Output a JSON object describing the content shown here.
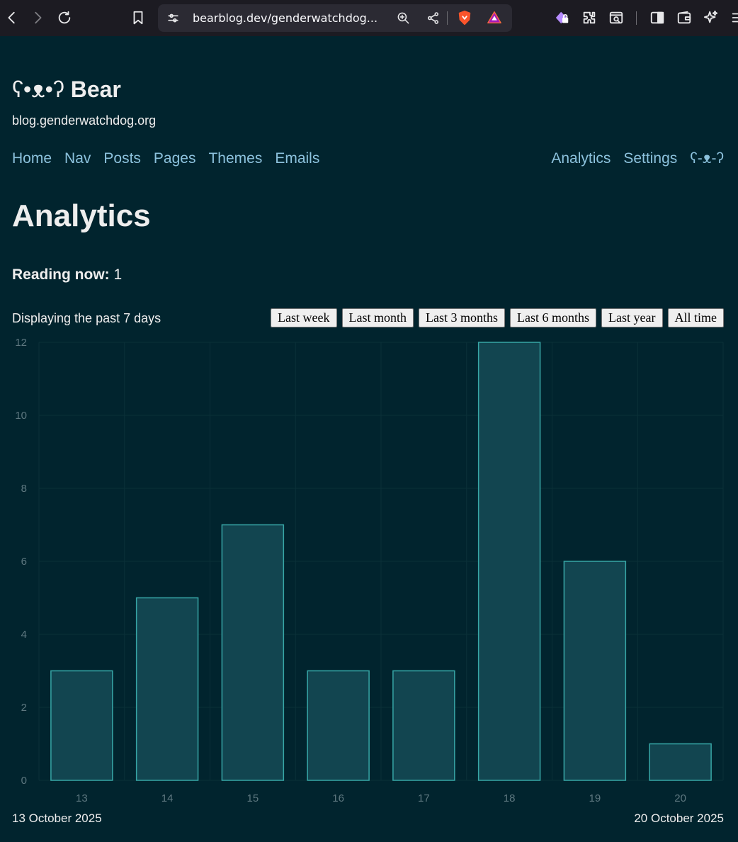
{
  "browser": {
    "url": "bearblog.dev/genderwatchdog...",
    "icons": [
      "back-icon",
      "forward-icon",
      "reload-icon",
      "bookmark-icon",
      "site-info-icon",
      "zoom-icon",
      "share-icon",
      "brave-shields-icon",
      "brave-rewards-icon",
      "vpn-icon",
      "extensions-icon",
      "reader-mode-icon",
      "sidebar-icon",
      "wallet-icon",
      "leo-ai-icon",
      "menu-icon"
    ]
  },
  "site": {
    "face": "ʕ•ᴥ•ʔ",
    "name": "Bear",
    "domain": "blog.genderwatchdog.org"
  },
  "nav": {
    "left": [
      "Home",
      "Nav",
      "Posts",
      "Pages",
      "Themes",
      "Emails"
    ],
    "right": [
      "Analytics",
      "Settings",
      "ʕ-ᴥ-ʔ"
    ]
  },
  "page": {
    "title": "Analytics",
    "reading_label": "Reading now:",
    "reading_value": "1",
    "displaying": "Displaying the past 7 days",
    "ranges": [
      "Last week",
      "Last month",
      "Last 3 months",
      "Last 6 months",
      "Last year",
      "All time"
    ],
    "date_start": "13 October 2025",
    "date_end": "20 October 2025"
  },
  "colors": {
    "background": "#01242e",
    "link": "#8cc2dd",
    "bar_fill": "#124550",
    "bar_stroke": "#37a6a6"
  },
  "chart_data": {
    "type": "bar",
    "categories": [
      "13",
      "14",
      "15",
      "16",
      "17",
      "18",
      "19",
      "20"
    ],
    "values": [
      3,
      5,
      7,
      3,
      3,
      12,
      6,
      1
    ],
    "yticks": [
      0,
      2,
      4,
      6,
      8,
      10,
      12
    ],
    "ylim": [
      0,
      12
    ],
    "grid": true,
    "title": "",
    "xlabel": "",
    "ylabel": ""
  }
}
